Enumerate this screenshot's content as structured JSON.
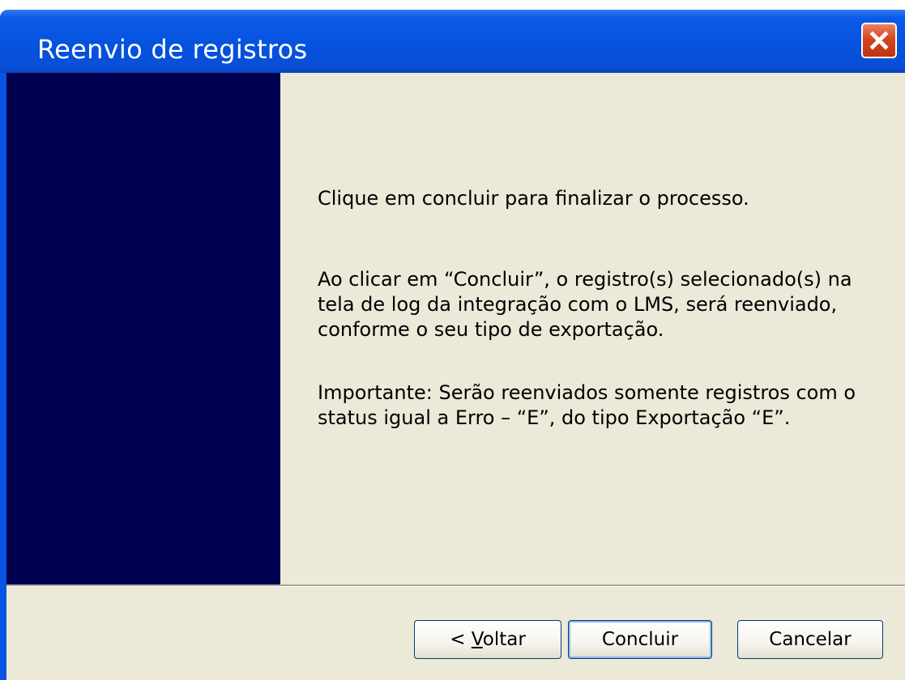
{
  "window": {
    "title": "Reenvio de registros"
  },
  "content": {
    "instruction": "Clique em concluir para finalizar o processo.",
    "description_lines": [
      "Ao clicar em “Concluir”, o registro(s) selecionado(s) na",
      "tela de log da integração com o LMS, será reenviado,",
      "conforme o seu tipo de exportação."
    ],
    "important_lines": [
      "Importante: Serão reenviados somente registros com o",
      "status igual a Erro – “E”, do tipo Exportação “E”."
    ]
  },
  "buttons": {
    "back_prefix": "< ",
    "back_mnemonic": "V",
    "back_rest": "oltar",
    "finish": "Concluir",
    "cancel": "Cancelar"
  },
  "colors": {
    "titlebar": "#0a54e3",
    "side_panel": "#000050",
    "dialog_background": "#ece9d8",
    "close_button": "#d4451e"
  },
  "icons": {
    "close": "close-x-icon"
  }
}
